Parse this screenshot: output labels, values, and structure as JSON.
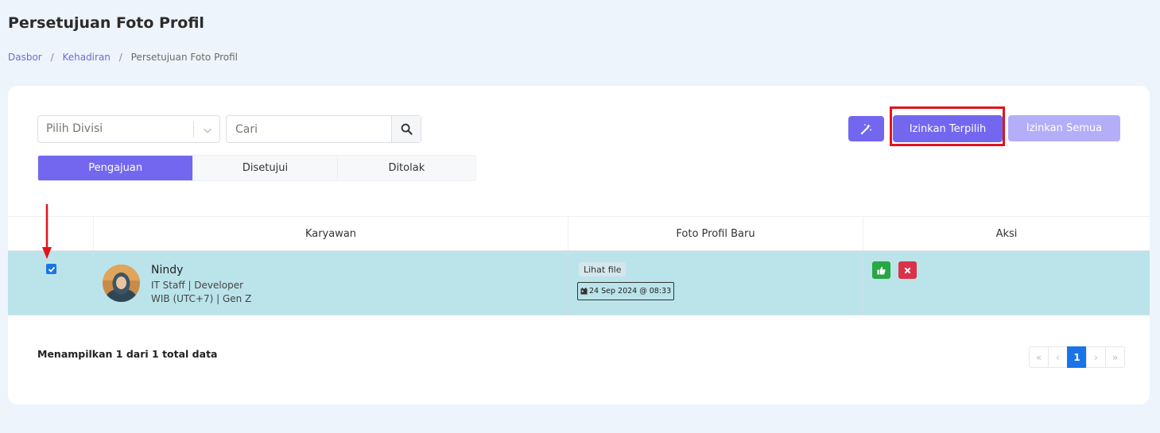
{
  "page_title": "Persetujuan Foto Profil",
  "breadcrumb": {
    "items": [
      "Dasbor",
      "Kehadiran",
      "Persetujuan Foto Profil"
    ],
    "separator": "/"
  },
  "filters": {
    "divisi_placeholder": "Pilih Divisi",
    "search_placeholder": "Cari"
  },
  "tabs": [
    {
      "label": "Pengajuan",
      "active": true
    },
    {
      "label": "Disetujui",
      "active": false
    },
    {
      "label": "Ditolak",
      "active": false
    }
  ],
  "actions": {
    "approve_selected_label": "Izinkan Terpilih",
    "approve_all_label": "Izinkan Semua",
    "magic_icon": "magic-wand-icon"
  },
  "table": {
    "headers": [
      "",
      "Karyawan",
      "Foto Profil Baru",
      "Aksi"
    ],
    "rows": [
      {
        "selected": true,
        "name": "Nindy",
        "position": "IT Staff | Developer",
        "timezone": "WIB (UTC+7) | Gen Z",
        "file_label": "Lihat file",
        "date": "24 Sep 2024 @ 08:33"
      }
    ]
  },
  "summary": "Menampilkan 1 dari 1 total data",
  "pagination": {
    "first": "«",
    "prev": "‹",
    "current": "1",
    "next": "›",
    "last": "»"
  },
  "colors": {
    "primary": "#7367f0",
    "selected_row": "#bae4ea",
    "approve": "#28a745",
    "reject": "#d9324a",
    "highlight": "#e0141b"
  }
}
